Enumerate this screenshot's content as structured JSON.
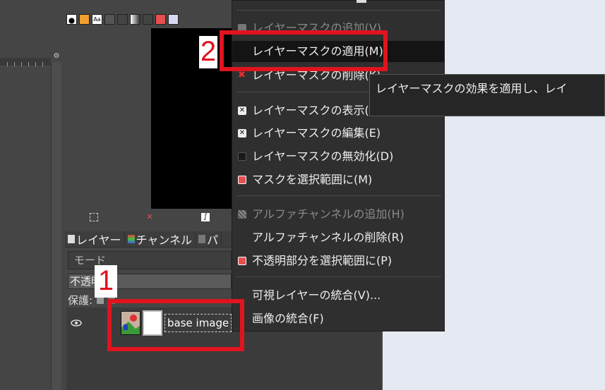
{
  "layers_panel": {
    "tabs": [
      {
        "label": "レイヤー"
      },
      {
        "label": "チャンネル"
      },
      {
        "label": "パ"
      }
    ],
    "mode_label": "モード",
    "opacity_label": "不透明",
    "lock_label": "保護:",
    "layer": {
      "name": "base image"
    }
  },
  "context_menu": {
    "items": [
      {
        "label": "レイヤーマスクの追加(V)",
        "state": "disabled",
        "icon": "add-mask-icon"
      },
      {
        "label": "レイヤーマスクの適用(M)",
        "state": "highlighted",
        "icon": "none"
      },
      {
        "label": "レイヤーマスクの削除(K)",
        "state": "normal",
        "icon": "delete-mask-icon"
      },
      {
        "label": "レイヤーマスクの表示(H)",
        "state": "normal",
        "icon": "checkbox-checked-icon"
      },
      {
        "label": "レイヤーマスクの編集(E)",
        "state": "normal",
        "icon": "checkbox-checked-icon"
      },
      {
        "label": "レイヤーマスクの無効化(D)",
        "state": "normal",
        "icon": "checkbox-unchecked-icon"
      },
      {
        "label": "マスクを選択範囲に(M)",
        "state": "normal",
        "icon": "mask-to-selection-icon"
      },
      {
        "label": "アルファチャンネルの追加(H)",
        "state": "disabled",
        "icon": "add-alpha-icon"
      },
      {
        "label": "アルファチャンネルの削除(R)",
        "state": "normal",
        "icon": "none"
      },
      {
        "label": "不透明部分を選択範囲に(P)",
        "state": "normal",
        "icon": "alpha-to-selection-icon"
      },
      {
        "label": "可視レイヤーの統合(V)...",
        "state": "normal",
        "icon": "none"
      },
      {
        "label": "画像の統合(F)",
        "state": "normal",
        "icon": "none"
      }
    ]
  },
  "tooltip": {
    "text": "レイヤーマスクの効果を適用し、レイ"
  },
  "annotations": {
    "one": "1",
    "two": "2",
    "color": "#e0141e"
  },
  "colors": {
    "menu_bg": "#2f2f2f",
    "highlight": "#141414",
    "panel": "#454545",
    "desktop": "#e4e9f2"
  }
}
